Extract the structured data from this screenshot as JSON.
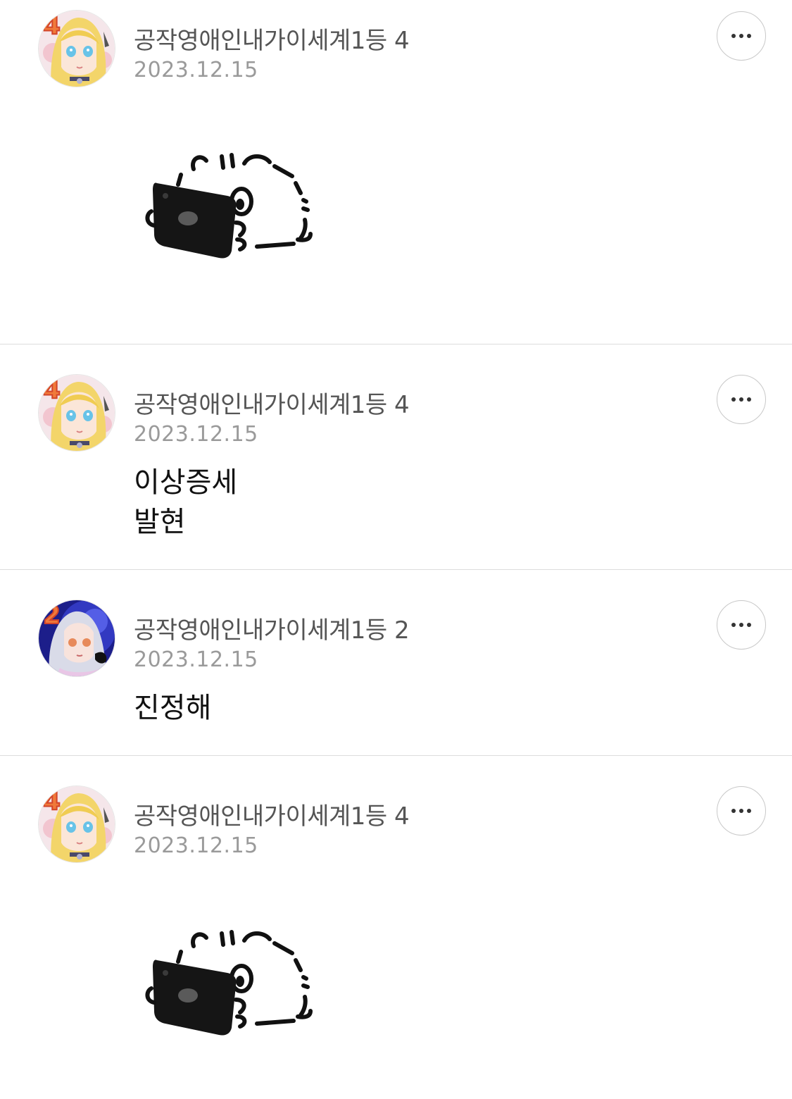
{
  "comments": [
    {
      "author": "공작영애인내가이세계1등 4",
      "badge": "4",
      "date": "2023.12.15",
      "text": "",
      "sticker": "hamster-with-tablet-sticker",
      "avatar_theme": "blonde"
    },
    {
      "author": "공작영애인내가이세계1등 4",
      "badge": "4",
      "date": "2023.12.15",
      "text": "이상증세\n발현",
      "avatar_theme": "blonde"
    },
    {
      "author": "공작영애인내가이세계1등 2",
      "badge": "2",
      "date": "2023.12.15",
      "text": "진정해",
      "avatar_theme": "silver-night"
    },
    {
      "author": "공작영애인내가이세계1등 4",
      "badge": "4",
      "date": "2023.12.15",
      "text": "",
      "sticker": "hamster-with-tablet-sticker",
      "avatar_theme": "blonde"
    }
  ],
  "icons": {
    "more": "more-horizontal-icon"
  },
  "colors": {
    "author": "#555555",
    "date": "#9a9a9a",
    "body": "#111111",
    "badge": "#f07a3a",
    "divider": "#dcdcdc"
  }
}
